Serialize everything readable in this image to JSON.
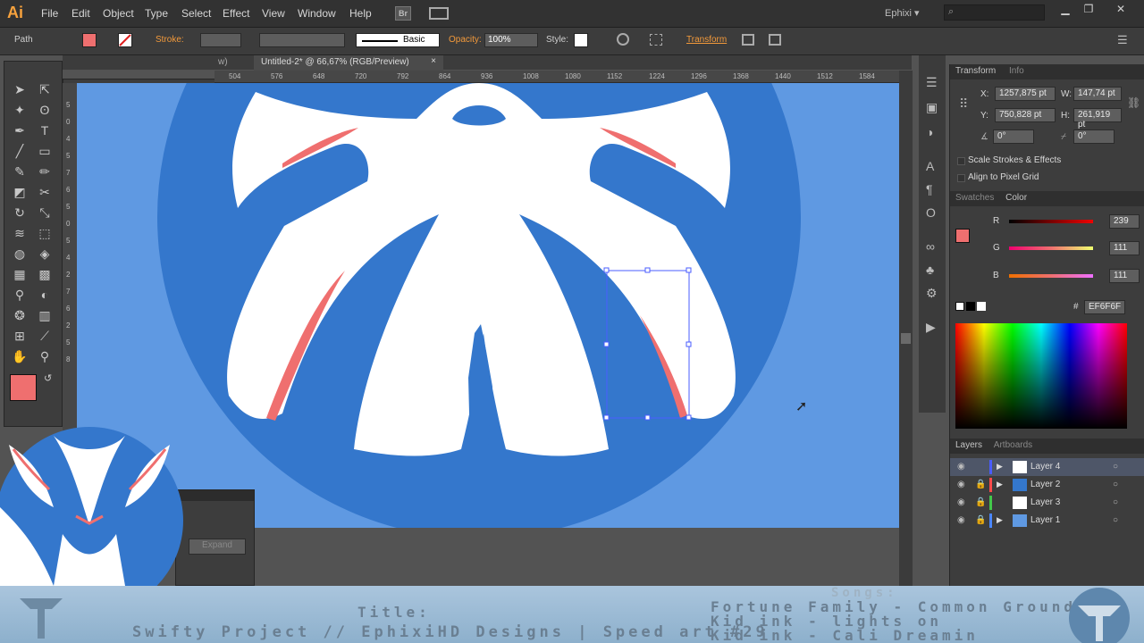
{
  "app": {
    "logo": "Ai",
    "menu": [
      "File",
      "Edit",
      "Object",
      "Type",
      "Select",
      "Effect",
      "View",
      "Window",
      "Help"
    ],
    "bridge_label": "Br",
    "workspace": "Ephixi",
    "workspace_caret": "▾"
  },
  "control": {
    "selection_type": "Path",
    "stroke_label": "Stroke:",
    "brush_style": "Basic",
    "opacity_label": "Opacity:",
    "opacity_value": "100%",
    "style_label": "Style:",
    "transform_label": "Transform"
  },
  "document": {
    "tab_prev": "w)",
    "tab_title": "Untitled-2* @ 66,67% (RGB/Preview)",
    "tab_close": "×"
  },
  "ruler_h": [
    "504",
    "576",
    "648",
    "720",
    "792",
    "864",
    "936",
    "1008",
    "1080",
    "1152",
    "1224",
    "1296",
    "1368",
    "1440",
    "1512",
    "1584"
  ],
  "ruler_v": [
    "5",
    "0",
    "4",
    "5",
    "7",
    "6",
    "5",
    "0",
    "5",
    "4",
    "2",
    "7",
    "6",
    "2",
    "5",
    "8"
  ],
  "transform_panel": {
    "tab_transform": "Transform",
    "tab_info": "Info",
    "x_label": "X:",
    "x_value": "1257,875 pt",
    "w_label": "W:",
    "w_value": "147,74 pt",
    "y_label": "Y:",
    "y_value": "750,828 pt",
    "h_label": "H:",
    "h_value": "261,919 pt",
    "angle_value": "0°",
    "shear_value": "0°",
    "scale_strokes": "Scale Strokes & Effects",
    "align_pixel": "Align to Pixel Grid"
  },
  "color_panel": {
    "tab_swatches": "Swatches",
    "tab_color": "Color",
    "r_label": "R",
    "r_value": "239",
    "g_label": "G",
    "g_value": "111",
    "b_label": "B",
    "b_value": "111",
    "hash": "#",
    "hex_value": "EF6F6F",
    "r": 239,
    "g": 111,
    "b": 111,
    "fill_color": "#ef6f6f"
  },
  "layers_panel": {
    "tab_layers": "Layers",
    "tab_artboards": "Artboards",
    "layers": [
      {
        "name": "Layer 4",
        "color": "#4a5cff",
        "selected": true
      },
      {
        "name": "Layer 2",
        "color": "#ff4a4a",
        "selected": false
      },
      {
        "name": "Layer 3",
        "color": "#43c84a",
        "selected": false
      },
      {
        "name": "Layer 1",
        "color": "#4a86ff",
        "selected": false
      }
    ]
  },
  "float_panel": {
    "expand_label": "Expand"
  },
  "footer": {
    "title_label": "Title:",
    "title_text": "Swifty Project // EphixiHD Designs | Speed art #29",
    "songs_label": "Songs:",
    "songs": [
      "Fortune Family - Common Ground",
      "Kid ink - lights on",
      "Kid ink - Cali Dreamin"
    ]
  },
  "colors": {
    "artboard_bg": "#5f99e2",
    "circle": "#3477cc",
    "accent_red": "#ef6f6f",
    "white": "#ffffff",
    "ui_dark": "#323232"
  }
}
